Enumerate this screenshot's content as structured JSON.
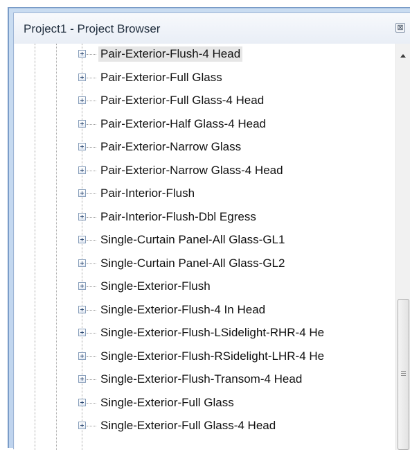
{
  "window": {
    "title": "Project1 - Project Browser",
    "close_glyph": "⊠"
  },
  "tree": {
    "selected_index": 0,
    "items": [
      {
        "label": "Pair-Exterior-Flush-4 Head"
      },
      {
        "label": "Pair-Exterior-Full Glass"
      },
      {
        "label": "Pair-Exterior-Full Glass-4 Head"
      },
      {
        "label": "Pair-Exterior-Half Glass-4 Head"
      },
      {
        "label": "Pair-Exterior-Narrow Glass"
      },
      {
        "label": "Pair-Exterior-Narrow Glass-4 Head"
      },
      {
        "label": "Pair-Interior-Flush"
      },
      {
        "label": "Pair-Interior-Flush-Dbl Egress"
      },
      {
        "label": "Single-Curtain Panel-All Glass-GL1"
      },
      {
        "label": "Single-Curtain Panel-All Glass-GL2"
      },
      {
        "label": "Single-Exterior-Flush"
      },
      {
        "label": "Single-Exterior-Flush-4 In Head"
      },
      {
        "label": "Single-Exterior-Flush-LSidelight-RHR-4 He"
      },
      {
        "label": "Single-Exterior-Flush-RSidelight-LHR-4 He"
      },
      {
        "label": "Single-Exterior-Flush-Transom-4 Head"
      },
      {
        "label": "Single-Exterior-Full Glass"
      },
      {
        "label": "Single-Exterior-Full Glass-4 Head"
      }
    ]
  },
  "icons": {
    "expander": "plus-box-icon",
    "scroll_up": "triangle-up-icon",
    "thumb_grip": "grip-lines-icon"
  },
  "colors": {
    "frame": "#7a9cc8",
    "selected_row": "#e6e6e6"
  }
}
